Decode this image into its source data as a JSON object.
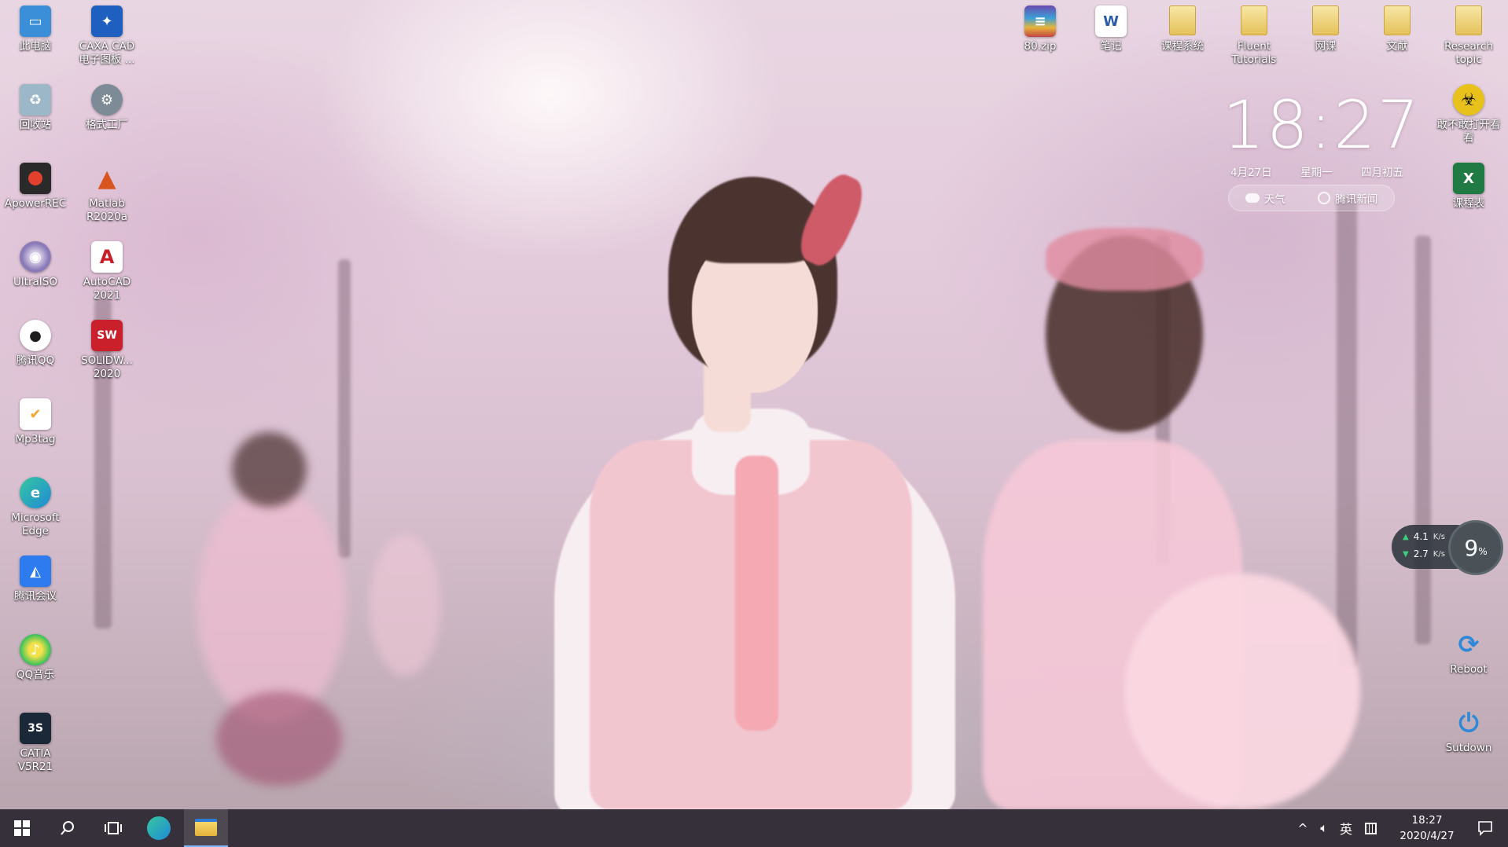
{
  "desktop": {
    "left_column_1": [
      {
        "label": "此电脑",
        "icon": "computer-icon",
        "color": "#3b8ed8"
      },
      {
        "label": "回收站",
        "icon": "recycle-bin-icon",
        "color": "#9bb7c8"
      },
      {
        "label": "ApowerREC",
        "icon": "apowerrec-icon",
        "color": "#e0402c"
      },
      {
        "label": "UltraISO",
        "icon": "ultraiso-icon",
        "color": "#8a7bb8"
      },
      {
        "label": "腾讯QQ",
        "icon": "qq-penguin-icon",
        "color": "#1d1d1d"
      },
      {
        "label": "Mp3tag",
        "icon": "mp3tag-icon",
        "color": "#f1a62b"
      },
      {
        "label": "Microsoft\nEdge",
        "icon": "edge-icon",
        "color": "#1f8ad6"
      },
      {
        "label": "腾讯会议",
        "icon": "tencent-meeting-icon",
        "color": "#2e7bf0"
      },
      {
        "label": "QQ音乐",
        "icon": "qq-music-icon",
        "color": "#33c25a"
      },
      {
        "label": "CATIA\nV5R21",
        "icon": "catia-icon",
        "color": "#1b2838"
      }
    ],
    "left_column_2": [
      {
        "label": "CAXA CAD\n电子图板 ...",
        "icon": "caxa-icon",
        "color": "#1f5fbf"
      },
      {
        "label": "格式工厂",
        "icon": "format-factory-icon",
        "color": "#7d8b96"
      },
      {
        "label": "Matlab\nR2020a",
        "icon": "matlab-icon",
        "color": "#d9551f"
      },
      {
        "label": "AutoCAD\n2021",
        "icon": "autocad-icon",
        "color": "#c8202a"
      },
      {
        "label": "SOLIDW...\n2020",
        "icon": "solidworks-icon",
        "color": "#c9202c"
      }
    ],
    "top_row": [
      {
        "label": "80.zip",
        "icon": "winrar-archive-icon",
        "color": "#6a4ab0"
      },
      {
        "label": "笔记",
        "icon": "word-document-icon",
        "color": "#2b5ca8"
      },
      {
        "label": "课程系统",
        "icon": "folder-icon",
        "color": "#e5c15a"
      },
      {
        "label": "Fluent\nTutorials",
        "icon": "folder-icon",
        "color": "#e5c15a"
      },
      {
        "label": "网课",
        "icon": "folder-icon",
        "color": "#e5c15a"
      },
      {
        "label": "文献",
        "icon": "folder-icon",
        "color": "#e5c15a"
      },
      {
        "label": "Research\ntopic",
        "icon": "folder-icon",
        "color": "#e5c15a"
      }
    ],
    "right_column": [
      {
        "label": "敢不敢打开看\n看",
        "icon": "biohazard-icon",
        "color": "#e8c21a"
      },
      {
        "label": "课程表",
        "icon": "excel-icon",
        "color": "#1f7a44"
      },
      {
        "label": "Reboot",
        "icon": "reboot-icon",
        "color": "#2e8ad8"
      },
      {
        "label": "Sutdown",
        "icon": "power-icon",
        "color": "#2e8ad8"
      }
    ]
  },
  "clock_widget": {
    "time": "18:27",
    "date": "4月27日",
    "weekday": "星期一",
    "lunar": "四月初五",
    "weather_label": "天气",
    "news_label": "腾讯新闻"
  },
  "net_widget": {
    "upload_value": "4.1",
    "upload_unit": "K/s",
    "download_value": "2.7",
    "download_unit": "K/s",
    "cpu_value": "9",
    "cpu_unit": "%"
  },
  "taskbar": {
    "buttons": [
      "start-button",
      "search-button",
      "task-view-button",
      "edge-taskbar-button",
      "file-explorer-button"
    ],
    "ime_label": "英",
    "time": "18:27",
    "date": "2020/4/27",
    "accent": "#7fb6ff"
  }
}
